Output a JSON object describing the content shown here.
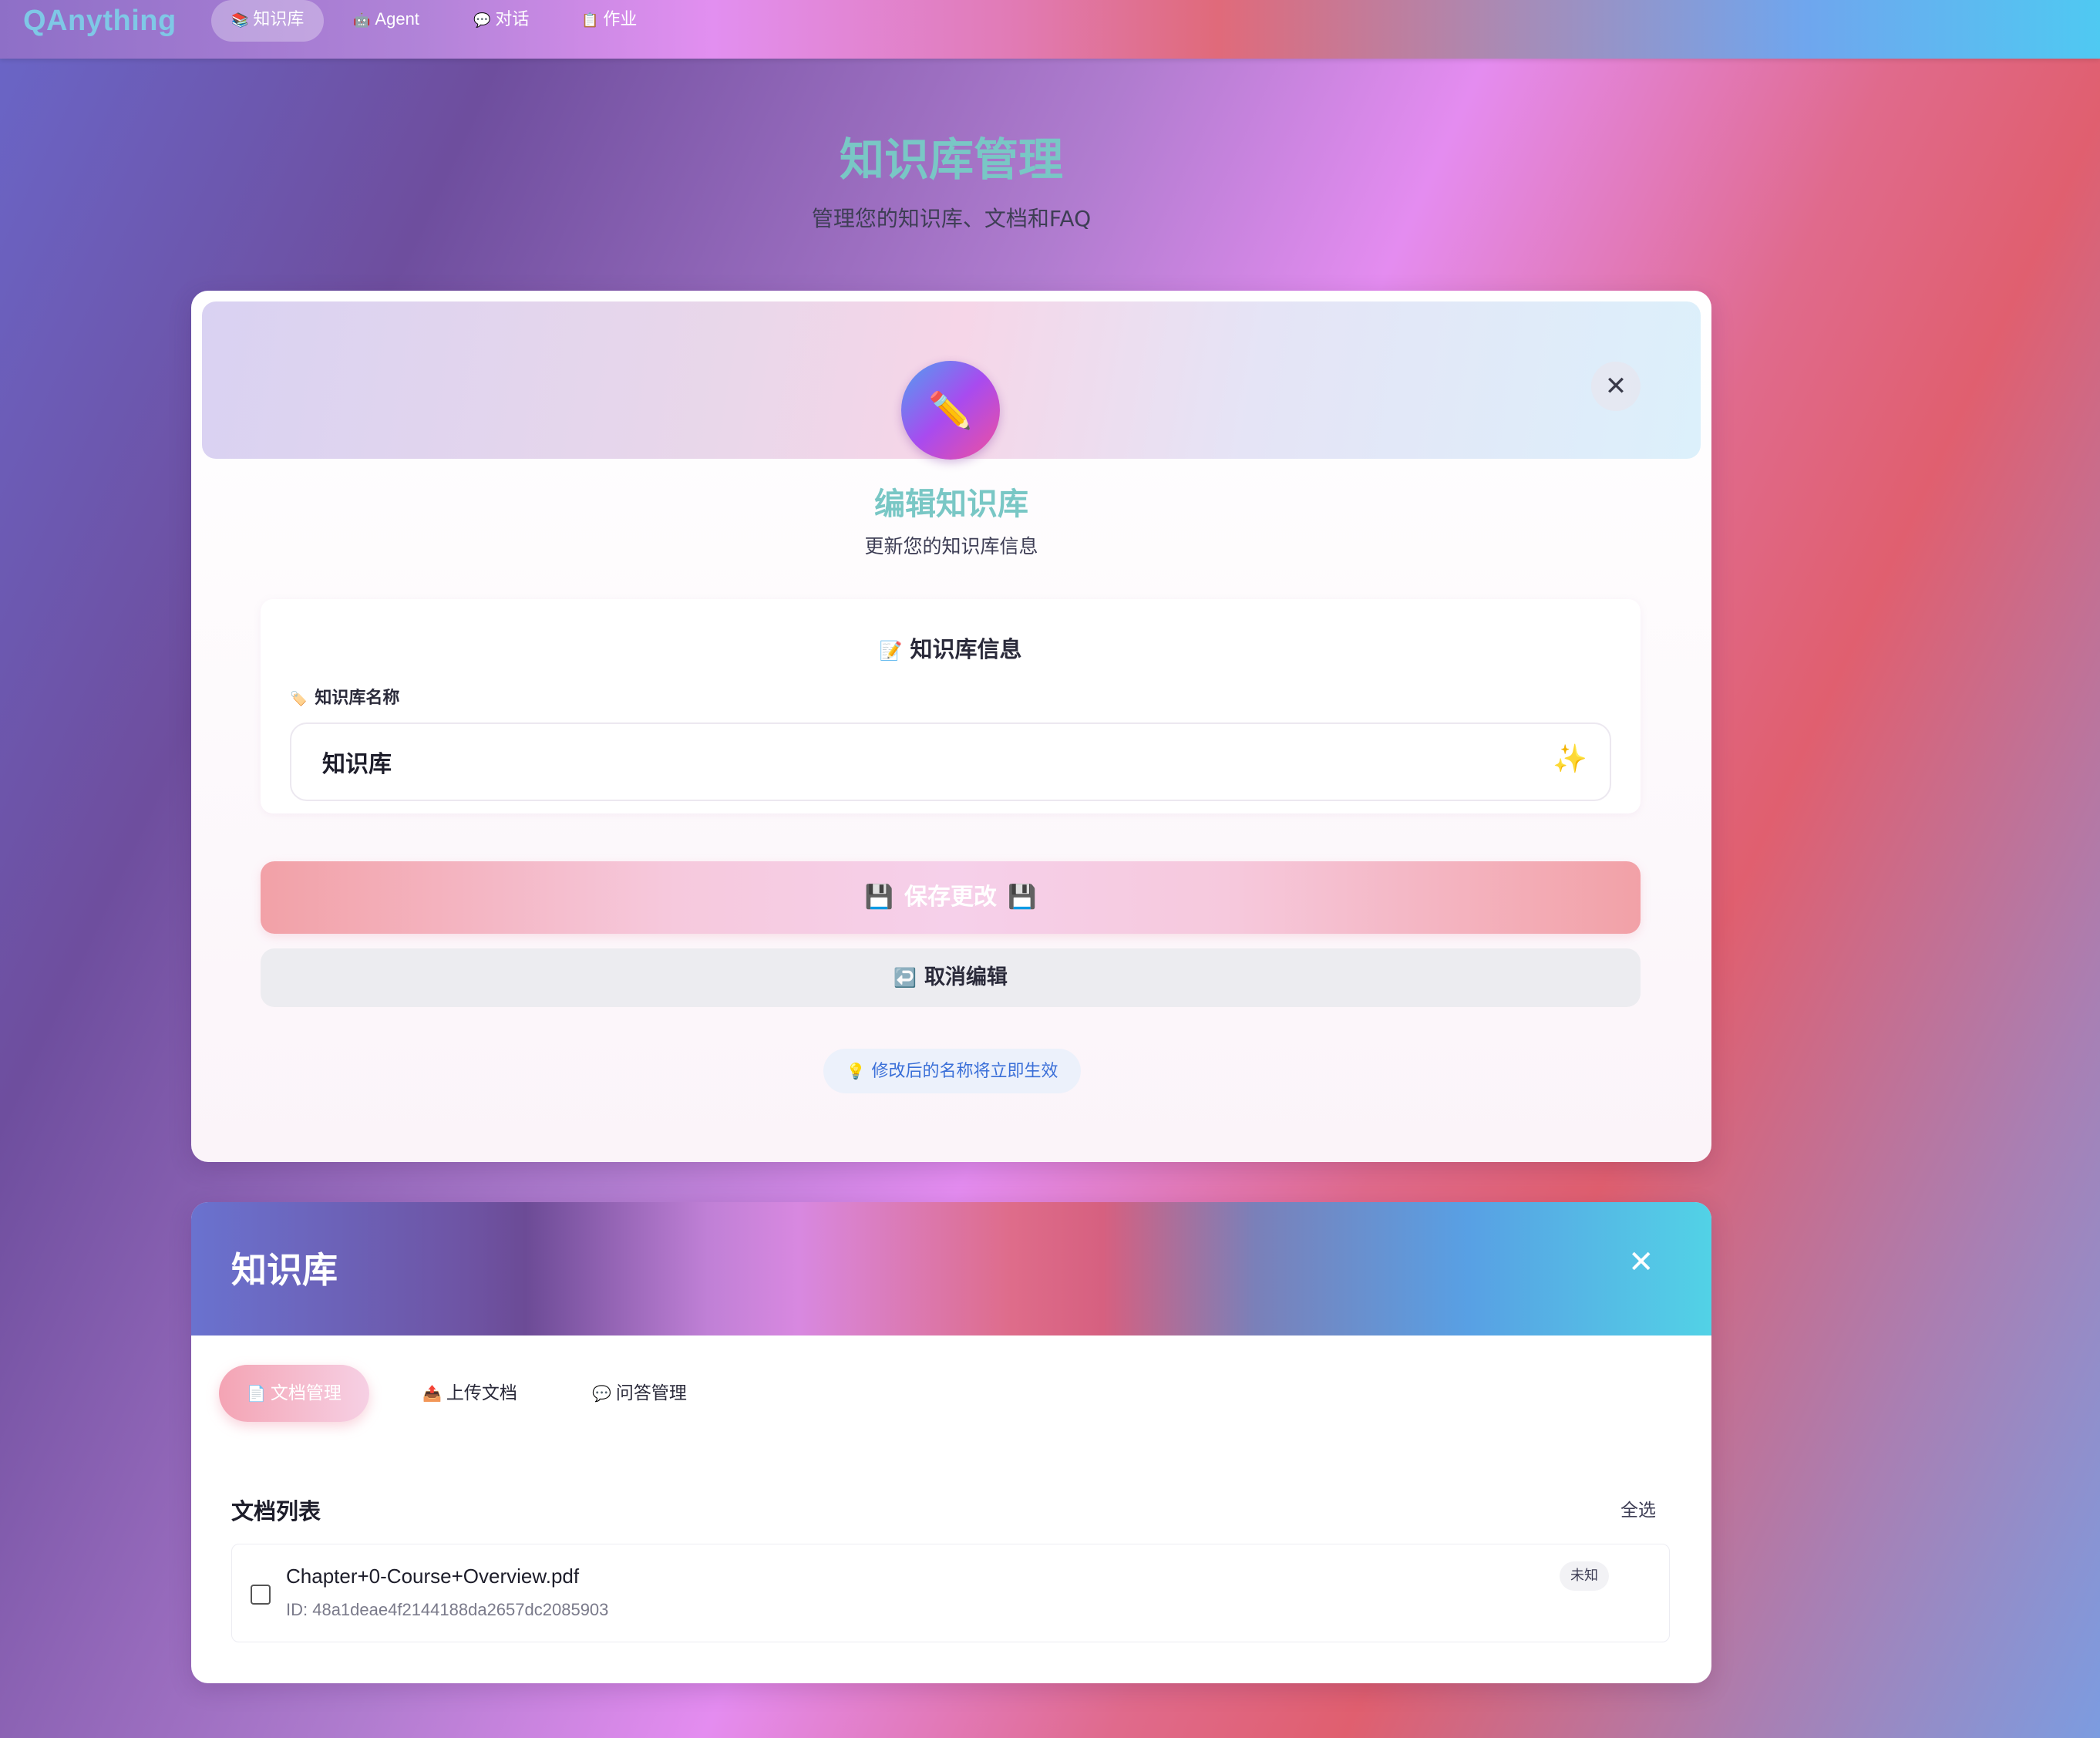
{
  "app": {
    "logo": "QAnything"
  },
  "nav": {
    "tabs": [
      {
        "icon": "📚",
        "label": "知识库",
        "active": true
      },
      {
        "icon": "🤖",
        "label": "Agent",
        "active": false
      },
      {
        "icon": "💬",
        "label": "对话",
        "active": false
      },
      {
        "icon": "📋",
        "label": "作业",
        "active": false
      }
    ]
  },
  "page": {
    "title": "知识库管理",
    "subtitle": "管理您的知识库、文档和FAQ"
  },
  "edit_card": {
    "avatar_icon": "✏️",
    "close_icon": "✕",
    "title": "编辑知识库",
    "subtitle": "更新您的知识库信息",
    "info_section": {
      "icon": "📝",
      "title": "知识库信息",
      "field_icon": "🏷️",
      "field_label": "知识库名称",
      "field_value": "知识库",
      "sparkle_icon": "✨"
    },
    "save_button": {
      "icon": "💾",
      "label": "保存更改"
    },
    "cancel_button": {
      "icon": "↩️",
      "label": "取消编辑"
    },
    "hint": {
      "icon": "💡",
      "text": "修改后的名称将立即生效"
    }
  },
  "kb_panel": {
    "title": "知识库",
    "close_icon": "✕",
    "tabs": [
      {
        "icon": "📄",
        "label": "文档管理",
        "active": true
      },
      {
        "icon": "📤",
        "label": "上传文档",
        "active": false
      },
      {
        "icon": "💬",
        "label": "问答管理",
        "active": false
      }
    ],
    "list_title": "文档列表",
    "select_all": "全选",
    "documents": [
      {
        "name": "Chapter+0-Course+Overview.pdf",
        "id": "ID: 48a1deae4f2144188da2657dc2085903",
        "status": "未知",
        "checked": false
      }
    ]
  },
  "colors": {
    "accent_title": "#79c7c5",
    "hint_text": "#3a6fd8"
  }
}
